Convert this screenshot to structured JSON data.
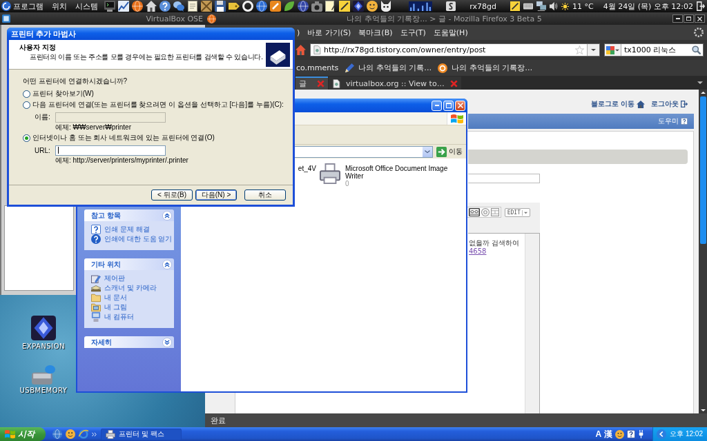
{
  "top_panel": {
    "menus": [
      "프로그램",
      "위치",
      "시스템"
    ],
    "user": "rx78gd",
    "temperature": "11 °C",
    "clock": "4월 24일 (목) 오후 12:02"
  },
  "virtualbox_window": {
    "title": "VirtualBox OSE"
  },
  "firefox_window": {
    "title": "나의 추억들의 기록장... > 글 - Mozilla Firefox 3 Beta 5",
    "menus": [
      ")",
      "바로 가기(S)",
      "북마크(B)",
      "도구(T)",
      "도움말(H)"
    ],
    "url": "http://rx78gd.tistory.com/owner/entry/post",
    "search": {
      "value": "tx1000 리눅스"
    },
    "bookmarks": [
      {
        "label": "co.mments",
        "kind": "plain"
      },
      {
        "label": "나의 추억들의 기록…",
        "kind": "edit"
      },
      {
        "label": "나의 추억들의 기록장…",
        "kind": "feed"
      }
    ],
    "tabs": [
      {
        "label": "글",
        "selected": true,
        "kind": "plain"
      },
      {
        "label": "virtualbox.org :: View to…",
        "selected": false,
        "kind": "site"
      }
    ],
    "page": {
      "blog_link": "블로그로 이동",
      "logout_link": "로그아웃",
      "help_link": "도우미",
      "editor_menu": "EDIT",
      "editor_text": "없을까 검색하여",
      "editor_link": "4658"
    },
    "status": "완료"
  },
  "desktop_icons": [
    {
      "label": "EXPANSION",
      "kind": "game"
    },
    {
      "label": "USBMEMORY",
      "kind": "drive"
    }
  ],
  "printers_window": {
    "go_button": "이동",
    "task_panels": [
      {
        "title": "참고 항목",
        "expanded": true,
        "items": [
          {
            "label": "인쇄 문제 해결",
            "kind": "troubleshoot"
          },
          {
            "label": "인쇄에 대한 도움 얻기",
            "kind": "help"
          }
        ]
      },
      {
        "title": "기타 위치",
        "expanded": true,
        "items": [
          {
            "label": "제어판",
            "kind": "controlpanel"
          },
          {
            "label": "스캐너 및 카메라",
            "kind": "scanner"
          },
          {
            "label": "내 문서",
            "kind": "documents"
          },
          {
            "label": "내 그림",
            "kind": "pictures"
          },
          {
            "label": "내 컴퓨터",
            "kind": "computer"
          }
        ]
      },
      {
        "title": "자세히",
        "expanded": false
      }
    ],
    "printers": [
      {
        "name": "et_4V",
        "kind": "partial"
      },
      {
        "name": "Microsoft Office Document Image Writer",
        "status": "0",
        "kind": "full"
      }
    ]
  },
  "add_printer_wizard": {
    "title": "프린터 추가 마법사",
    "heading": "사용자 지정",
    "subheading": "프린터의 이름 또는 주소를 모를 경우에는 필요한 프린터를 검색할 수 있습니다.",
    "question": "어떤 프린터에 연결하시겠습니까?",
    "options": [
      {
        "label": "프린터 찾아보기(W)",
        "selected": false
      },
      {
        "label": "다음 프린터에 연결(또는 프린터를 찾으려면 이 옵션을 선택하고 [다음]를 누름)(C):",
        "selected": false,
        "field": {
          "label": "이름:",
          "disabled": true,
          "focused": false,
          "example": "예제: ₩₩server₩printer"
        }
      },
      {
        "label": "인터넷이나 홈 또는 회사 네트워크에 있는 프린터에 연결(O)",
        "selected": true,
        "field": {
          "label": "URL:",
          "disabled": false,
          "focused": true,
          "example": "예제: http://server/printers/myprinter/.printer"
        }
      }
    ],
    "buttons": [
      {
        "label": "< 뒤로(B)",
        "default": false
      },
      {
        "label": "다음(N) >",
        "default": true
      },
      {
        "label": "취소",
        "default": false
      }
    ]
  },
  "taskbar": {
    "start": "시작",
    "tasks": [
      {
        "label": "프린터 및 팩스"
      }
    ],
    "ime": [
      "A",
      "漢"
    ],
    "clock": "오후 12:02"
  }
}
